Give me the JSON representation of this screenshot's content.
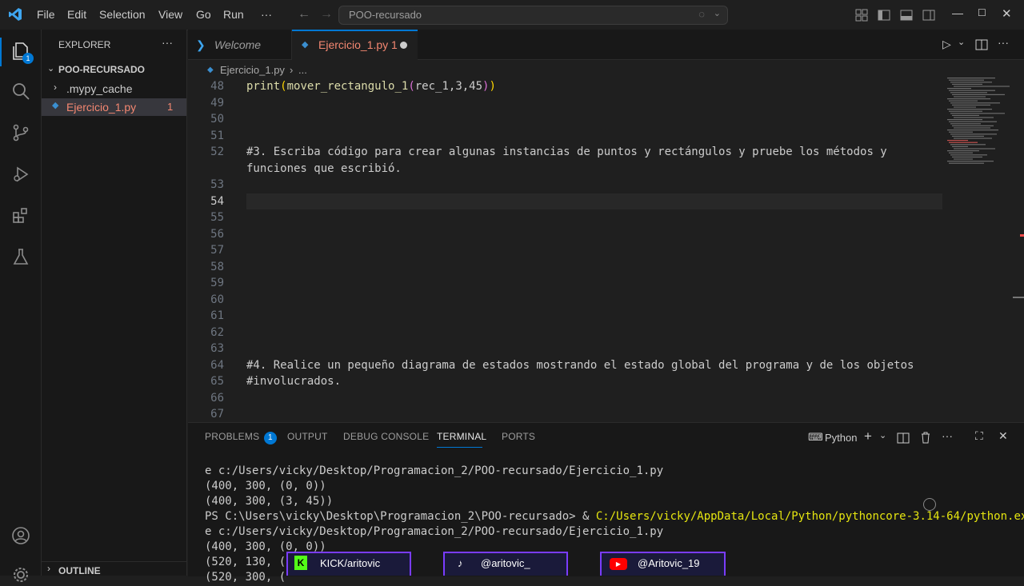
{
  "titlebar": {
    "menus": [
      "File",
      "Edit",
      "Selection",
      "View",
      "Go",
      "Run",
      "···"
    ],
    "search_text": "POO-recursado"
  },
  "activity": {
    "explorer_badge": "1"
  },
  "explorer": {
    "title": "EXPLORER",
    "folder": "POO-RECURSADO",
    "items": [
      {
        "label": ".mypy_cache",
        "badge": ""
      },
      {
        "label": "Ejercicio_1.py",
        "badge": "1"
      }
    ],
    "outline": "OUTLINE"
  },
  "tabs": [
    {
      "label": "Welcome"
    },
    {
      "label": "Ejercicio_1.py 1"
    }
  ],
  "breadcrumb": {
    "file": "Ejercicio_1.py",
    "rest": "..."
  },
  "code_lines": [
    {
      "n": "48",
      "t": "print(mover_rectangulo_1(rec_1,3,45))"
    },
    {
      "n": "49",
      "t": ""
    },
    {
      "n": "50",
      "t": ""
    },
    {
      "n": "51",
      "t": ""
    },
    {
      "n": "52",
      "t": "#3. Escriba código para crear algunas instancias de puntos y rectángulos y pruebe los métodos y"
    },
    {
      "n": "",
      "t": "funciones que escribió."
    },
    {
      "n": "53",
      "t": ""
    },
    {
      "n": "54",
      "t": ""
    },
    {
      "n": "55",
      "t": ""
    },
    {
      "n": "56",
      "t": ""
    },
    {
      "n": "57",
      "t": ""
    },
    {
      "n": "58",
      "t": ""
    },
    {
      "n": "59",
      "t": ""
    },
    {
      "n": "60",
      "t": ""
    },
    {
      "n": "61",
      "t": ""
    },
    {
      "n": "62",
      "t": ""
    },
    {
      "n": "63",
      "t": ""
    },
    {
      "n": "64",
      "t": "#4. Realice un pequeño diagrama de estados mostrando el estado global del programa y de los objetos"
    },
    {
      "n": "65",
      "t": "#involucrados."
    },
    {
      "n": "66",
      "t": ""
    },
    {
      "n": "67",
      "t": ""
    }
  ],
  "panel": {
    "tabs": [
      "PROBLEMS",
      "OUTPUT",
      "DEBUG CONSOLE",
      "TERMINAL",
      "PORTS"
    ],
    "problems_badge": "1",
    "shell": "Python"
  },
  "terminal": {
    "line1": "e c:/Users/vicky/Desktop/Programacion_2/POO-recursado/Ejercicio_1.py",
    "line2": "(400, 300, (0, 0))",
    "line3": "(400, 300, (3, 45))",
    "line4_prompt": "PS C:\\Users\\vicky\\Desktop\\Programacion_2\\POO-recursado> & ",
    "line4_cmd": "C:/Users/vicky/AppData/Local/Python/pythoncore-3.14-64/python.ex",
    "line5": "e c:/Users/vicky/Desktop/Programacion_2/POO-recursado/Ejercicio_1.py",
    "line6": "(400, 300, (0, 0))",
    "line7": "(520, 130, (",
    "line8": "(520, 300, ("
  },
  "overlays": {
    "kick": "KICK/aritovic",
    "tiktok": "@aritovic_",
    "youtube": "@Aritovic_19"
  },
  "colors": {
    "accent": "#0078d4",
    "keyword": "#dcdcaa",
    "comment": "#cccccc",
    "error": "#f48771",
    "terminal_cmd": "#e5e510"
  }
}
